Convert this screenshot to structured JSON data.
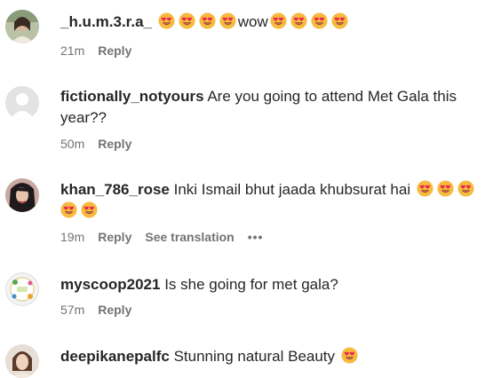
{
  "comments": [
    {
      "username": "_h.u.m.3.r.a_",
      "text_before": "",
      "emojis_1": 4,
      "text_middle": "wow",
      "emojis_2": 4,
      "time": "21m",
      "reply": "Reply",
      "avatar": "avatar-photo"
    },
    {
      "username": "fictionally_notyours",
      "text": "Are you going to attend Met Gala this",
      "text_line2": "year??",
      "time": "50m",
      "reply": "Reply",
      "avatar": "default-avatar-icon"
    },
    {
      "username": "khan_786_rose",
      "text": "Inki Ismail bhut jaada khubsurat hai",
      "emojis_line1": 3,
      "emojis_line2": 2,
      "time": "19m",
      "reply": "Reply",
      "see_translation": "See translation",
      "more": "•••",
      "avatar": "avatar-photo"
    },
    {
      "username": "myscoop2021",
      "text": "Is she going for met gala?",
      "time": "57m",
      "reply": "Reply",
      "avatar": "avatar-logo"
    },
    {
      "username": "deepikanepalfc",
      "text": "Stunning natural Beauty",
      "emojis": 1,
      "avatar": "avatar-photo"
    }
  ],
  "emoji_name": "heart-eyes-emoji",
  "colors": {
    "meta_gray": "#737373",
    "text": "#262626",
    "emoji_face": "#f7b93e",
    "emoji_heart": "#e8264f"
  }
}
